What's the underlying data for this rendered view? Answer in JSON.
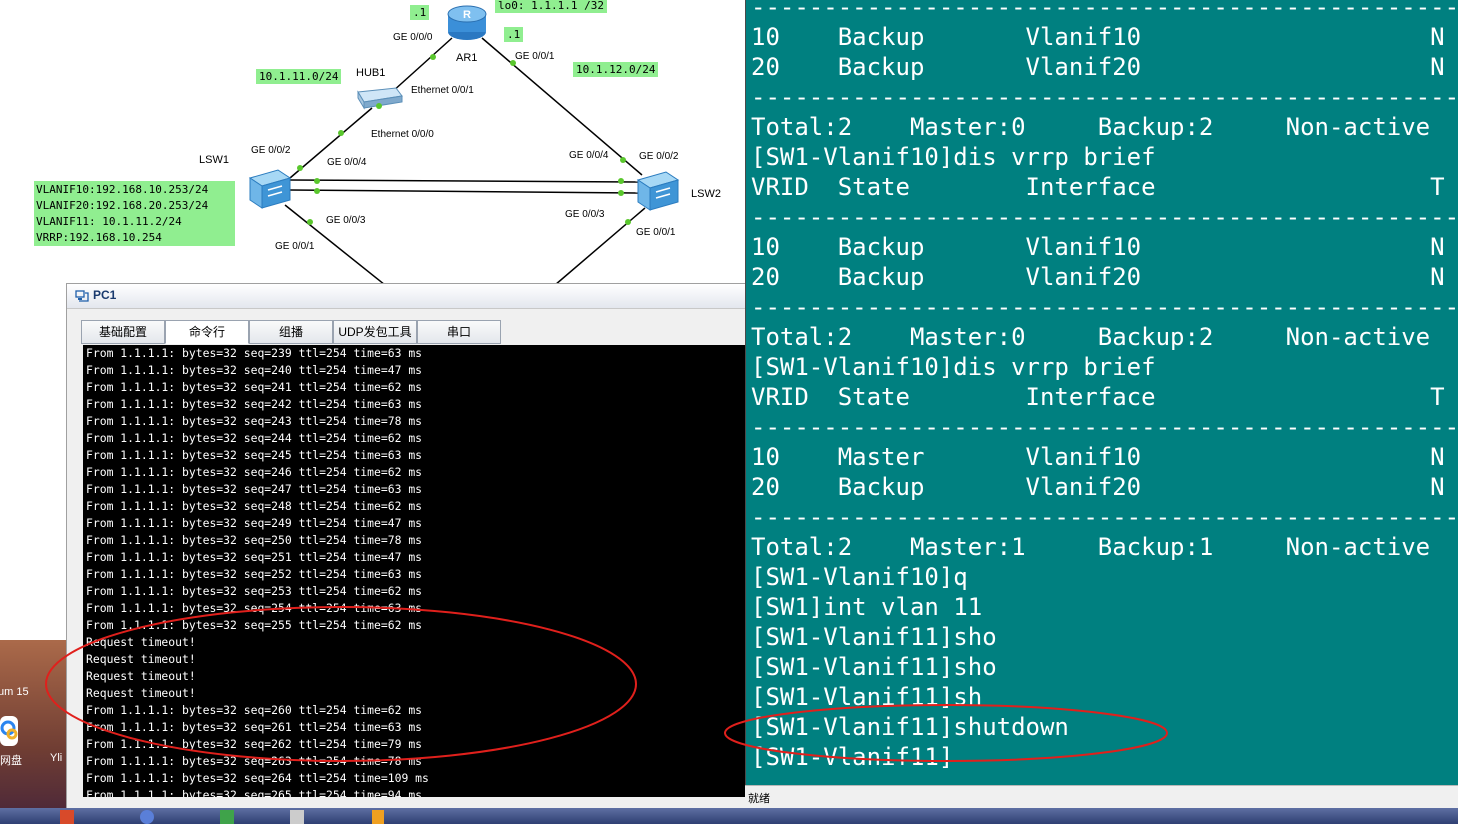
{
  "topology": {
    "router": {
      "name": "AR1",
      "loopback": "lo0: 1.1.1.1 /32",
      "port_left": "GE 0/0/0",
      "port_right": "GE 0/0/1",
      "ip_left": ".1",
      "ip_right": ".1"
    },
    "hub": {
      "name": "HUB1",
      "port_up": "Ethernet 0/0/1",
      "port_down": "Ethernet 0/0/0"
    },
    "net_left": "10.1.11.0/24",
    "net_right": "10.1.12.0/24",
    "lsw1": {
      "name": "LSW1",
      "p2": "GE 0/0/2",
      "p4": "GE 0/0/4",
      "p3": "GE 0/0/3",
      "p1": "GE 0/0/1",
      "info": [
        "VLANIF10:192.168.10.253/24",
        "VLANIF20:192.168.20.253/24",
        "VLANIF11: 10.1.11.2/24",
        "VRRP:192.168.10.254"
      ]
    },
    "lsw2": {
      "name": "LSW2",
      "p4": "GE 0/0/4",
      "p2": "GE 0/0/2",
      "p3": "GE 0/0/3",
      "p1": "GE 0/0/1"
    },
    "colors": {
      "label_bg": "#90ee90",
      "link_dot": "#5ac72d"
    }
  },
  "pc1": {
    "title": "PC1",
    "tabs": [
      "基础配置",
      "命令行",
      "组播",
      "UDP发包工具",
      "串口"
    ],
    "console_lines": [
      "From 1.1.1.1: bytes=32 seq=239 ttl=254 time=63 ms",
      "From 1.1.1.1: bytes=32 seq=240 ttl=254 time=47 ms",
      "From 1.1.1.1: bytes=32 seq=241 ttl=254 time=62 ms",
      "From 1.1.1.1: bytes=32 seq=242 ttl=254 time=63 ms",
      "From 1.1.1.1: bytes=32 seq=243 ttl=254 time=78 ms",
      "From 1.1.1.1: bytes=32 seq=244 ttl=254 time=62 ms",
      "From 1.1.1.1: bytes=32 seq=245 ttl=254 time=63 ms",
      "From 1.1.1.1: bytes=32 seq=246 ttl=254 time=62 ms",
      "From 1.1.1.1: bytes=32 seq=247 ttl=254 time=63 ms",
      "From 1.1.1.1: bytes=32 seq=248 ttl=254 time=62 ms",
      "From 1.1.1.1: bytes=32 seq=249 ttl=254 time=47 ms",
      "From 1.1.1.1: bytes=32 seq=250 ttl=254 time=78 ms",
      "From 1.1.1.1: bytes=32 seq=251 ttl=254 time=47 ms",
      "From 1.1.1.1: bytes=32 seq=252 ttl=254 time=63 ms",
      "From 1.1.1.1: bytes=32 seq=253 ttl=254 time=62 ms",
      "From 1.1.1.1: bytes=32 seq=254 ttl=254 time=63 ms",
      "From 1.1.1.1: bytes=32 seq=255 ttl=254 time=62 ms",
      "Request timeout!",
      "Request timeout!",
      "Request timeout!",
      "Request timeout!",
      "From 1.1.1.1: bytes=32 seq=260 ttl=254 time=62 ms",
      "From 1.1.1.1: bytes=32 seq=261 ttl=254 time=63 ms",
      "From 1.1.1.1: bytes=32 seq=262 ttl=254 time=79 ms",
      "From 1.1.1.1: bytes=32 seq=263 ttl=254 time=78 ms",
      "From 1.1.1.1: bytes=32 seq=264 ttl=254 time=109 ms",
      "From 1.1.1.1: bytes=32 seq=265 ttl=254 time=94 ms"
    ]
  },
  "sw1_terminal": {
    "lines": [
      "--------------------------------------------------------",
      "10    Backup       Vlanif10                    N",
      "20    Backup       Vlanif20                    N",
      "--------------------------------------------------------",
      "Total:2    Master:0     Backup:2     Non-active",
      "[SW1-Vlanif10]dis vrrp brief",
      "VRID  State        Interface                   T",
      "--------------------------------------------------------",
      "10    Backup       Vlanif10                    N",
      "20    Backup       Vlanif20                    N",
      "--------------------------------------------------------",
      "Total:2    Master:0     Backup:2     Non-active",
      "[SW1-Vlanif10]dis vrrp brief",
      "VRID  State        Interface                   T",
      "--------------------------------------------------------",
      "10    Master       Vlanif10                    N",
      "20    Backup       Vlanif20                    N",
      "--------------------------------------------------------",
      "Total:2    Master:1     Backup:1     Non-active",
      "[SW1-Vlanif10]q",
      "[SW1]int vlan 11",
      "[SW1-Vlanif11]sho",
      "[SW1-Vlanif11]sho",
      "[SW1-Vlanif11]sh",
      "[SW1-Vlanif11]shutdown",
      "[SW1-Vlanif11]"
    ],
    "status": "就绪",
    "colors": {
      "background": "#008080",
      "text": "#ffffff"
    }
  },
  "annotations": {
    "highlight_color": "#e0201c"
  },
  "desktop": {
    "label_left": "网盘",
    "label_right": "Yli",
    "label_top": "um 15"
  }
}
